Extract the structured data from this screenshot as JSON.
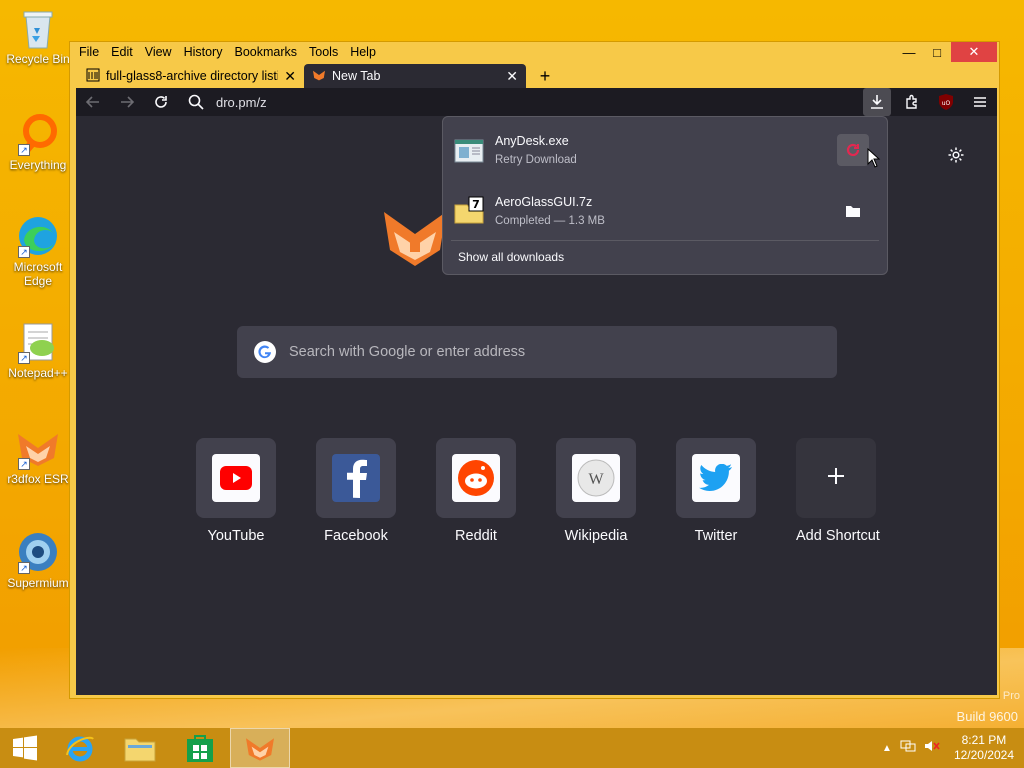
{
  "desktop": {
    "icons": [
      {
        "label": "Recycle Bin"
      },
      {
        "label": "Everything"
      },
      {
        "label": "Microsoft Edge"
      },
      {
        "label": "Notepad++"
      },
      {
        "label": "r3dfox ESR"
      },
      {
        "label": "Supermium"
      }
    ],
    "watermark": "Build 9600",
    "watermark_partial": "Pro"
  },
  "browser": {
    "menu": [
      "File",
      "Edit",
      "View",
      "History",
      "Bookmarks",
      "Tools",
      "Help"
    ],
    "tabs": [
      {
        "title": "full-glass8-archive directory listi"
      },
      {
        "title": "New Tab"
      }
    ],
    "address": "dro.pm/z",
    "search_placeholder": "Search with Google or enter address",
    "shortcuts": [
      {
        "label": "YouTube",
        "icon": "youtube-icon",
        "color": "#ff0000"
      },
      {
        "label": "Facebook",
        "icon": "facebook-icon",
        "color": "#3b5998"
      },
      {
        "label": "Reddit",
        "icon": "reddit-icon",
        "color": "#ff4500"
      },
      {
        "label": "Wikipedia",
        "icon": "wikipedia-icon",
        "color": "#cccccc"
      },
      {
        "label": "Twitter",
        "icon": "twitter-icon",
        "color": "#1da1f2"
      },
      {
        "label": "Add Shortcut",
        "icon": "plus-icon"
      }
    ],
    "downloads": {
      "items": [
        {
          "name": "AnyDesk.exe",
          "status": "Retry Download"
        },
        {
          "name": "AeroGlassGUI.7z",
          "status": "Completed — 1.3 MB"
        }
      ],
      "show_all": "Show all downloads"
    },
    "ublock_badge": "uO"
  },
  "taskbar": {
    "time": "8:21 PM",
    "date": "12/20/2024"
  },
  "colors": {
    "wallpaper": "#f5b000",
    "content_bg": "#2b2a33",
    "toolbar_bg": "#1c1b22",
    "panel_bg": "#42414d"
  }
}
